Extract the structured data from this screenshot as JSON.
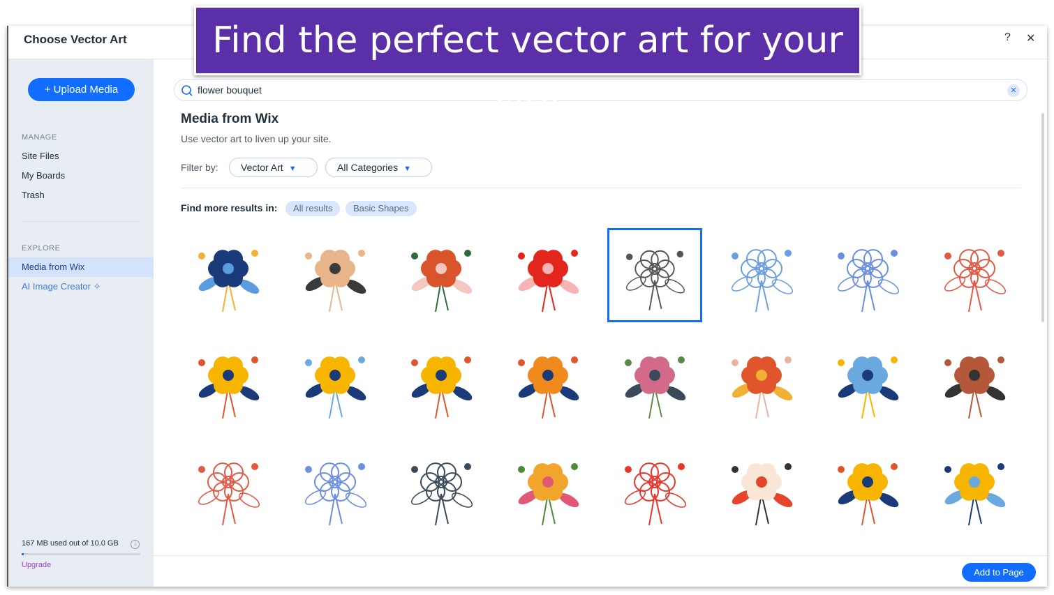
{
  "banner": "Find the perfect vector art for your site",
  "header": {
    "title": "Choose Vector Art",
    "help": "?",
    "close": "✕"
  },
  "sidebar": {
    "upload": "+ Upload Media",
    "manage": "MANAGE",
    "manage_items": [
      "Site Files",
      "My Boards",
      "Trash"
    ],
    "explore": "EXPLORE",
    "explore_items": [
      "Media from Wix",
      "AI Image Creator"
    ],
    "ai_icon": "✧",
    "storage": "167 MB used out of 10.0 GB",
    "storage_used_fraction": 0.0167,
    "upgrade": "Upgrade"
  },
  "search": {
    "value": "flower bouquet",
    "icon": "search-icon"
  },
  "main": {
    "title": "Media from Wix",
    "subtitle": "Use vector art to liven up your site.",
    "filter_label": "Filter by:",
    "filters": [
      "Vector Art",
      "All Categories"
    ],
    "more_label": "Find more results in:",
    "chips": [
      "All results",
      "Basic Shapes"
    ],
    "selected_index": 4,
    "tiles": [
      {
        "colors": [
          "#1a3a7a",
          "#5b9be0",
          "#f2b134"
        ]
      },
      {
        "colors": [
          "#e8b48a",
          "#3a3a3a",
          "#e8b48a"
        ]
      },
      {
        "colors": [
          "#d9532b",
          "#f4c7c0",
          "#2e6b3a"
        ]
      },
      {
        "colors": [
          "#e2261d",
          "#f7b4b4",
          "#e2261d"
        ]
      },
      {
        "colors": [
          "#555555",
          "#ffffff",
          "#555555"
        ]
      },
      {
        "colors": [
          "#6a9ee0",
          "#ffffff",
          "#6a9ee0"
        ]
      },
      {
        "colors": [
          "#6a8ee0",
          "#ffffff",
          "#6a8ee0"
        ]
      },
      {
        "colors": [
          "#e05a45",
          "#ffffff",
          "#e05a45"
        ]
      },
      {
        "colors": [
          "#f7b500",
          "#1a3a7a",
          "#e0552b"
        ]
      },
      {
        "colors": [
          "#f7b500",
          "#1a3a7a",
          "#6aa9e0"
        ]
      },
      {
        "colors": [
          "#f7b500",
          "#1a3a7a",
          "#e0552b"
        ]
      },
      {
        "colors": [
          "#f08a1c",
          "#1a3a7a",
          "#e0552b"
        ]
      },
      {
        "colors": [
          "#d46a8a",
          "#3a4a5a",
          "#5a8a4a"
        ]
      },
      {
        "colors": [
          "#e0552b",
          "#f2b134",
          "#e8b4a0"
        ]
      },
      {
        "colors": [
          "#6aa9e0",
          "#1a3a7a",
          "#f7b500"
        ]
      },
      {
        "colors": [
          "#b5583a",
          "#333333",
          "#b5583a"
        ]
      },
      {
        "colors": [
          "#e05a45",
          "#ffffff",
          "#e05a45"
        ]
      },
      {
        "colors": [
          "#6a8ee0",
          "#ffffff",
          "#6a8ee0"
        ]
      },
      {
        "colors": [
          "#3a4a5a",
          "#ffffff",
          "#3a4a5a"
        ]
      },
      {
        "colors": [
          "#f2a52b",
          "#e05a75",
          "#4a8a3a"
        ]
      },
      {
        "colors": [
          "#e8352a",
          "#ffffff",
          "#e8352a"
        ]
      },
      {
        "colors": [
          "#f9e6d6",
          "#e8442c",
          "#333333"
        ]
      },
      {
        "colors": [
          "#f7b500",
          "#1a3a7a",
          "#e0552b"
        ]
      },
      {
        "colors": [
          "#f7b500",
          "#6aa9e0",
          "#1a3a7a"
        ]
      }
    ]
  },
  "footer": {
    "add": "Add to Page"
  }
}
